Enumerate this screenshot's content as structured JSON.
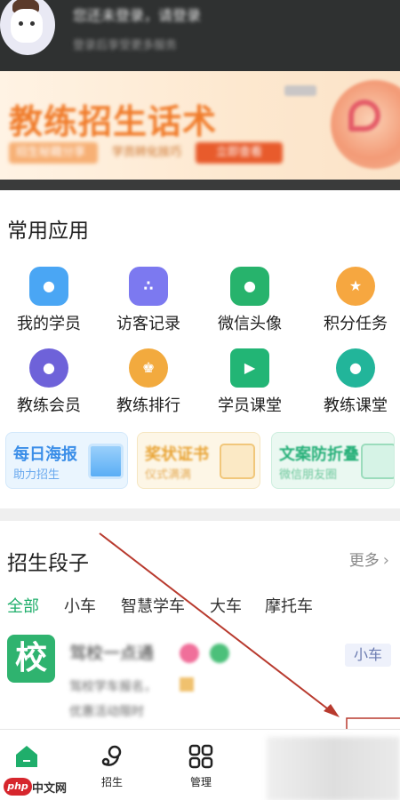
{
  "header": {
    "line1": "您还未登录，请登录",
    "line2": "登录后享受更多服务"
  },
  "banner": {
    "title": "教练招生话术",
    "chip1": "招生秘籍分享",
    "chip2": "学员转化技巧",
    "chip3": "立即查看"
  },
  "apps": {
    "title": "常用应用",
    "items": [
      {
        "label": "我的学员",
        "icon": "student-icon",
        "color": "#4aa6f4"
      },
      {
        "label": "访客记录",
        "icon": "footprint-icon",
        "color": "#7c79f0"
      },
      {
        "label": "微信头像",
        "icon": "profile-card-icon",
        "color": "#27b36c"
      },
      {
        "label": "积分任务",
        "icon": "star-icon",
        "color": "#f6a740"
      },
      {
        "label": "教练会员",
        "icon": "coach-member-icon",
        "color": "#6e62d9"
      },
      {
        "label": "教练排行",
        "icon": "trophy-icon",
        "color": "#f2aa3e"
      },
      {
        "label": "学员课堂",
        "icon": "video-play-icon",
        "color": "#22b575"
      },
      {
        "label": "教练课堂",
        "icon": "teacher-icon",
        "color": "#22b59a"
      }
    ],
    "promos": [
      {
        "title": "每日海报",
        "sub": "助力招生"
      },
      {
        "title": "奖状证书",
        "sub": "仪式满满"
      },
      {
        "title": "文案防折叠",
        "sub": "微信朋友圈"
      }
    ]
  },
  "recruit": {
    "title": "招生段子",
    "more": "更多",
    "tabs": [
      "全部",
      "小车",
      "智慧学车",
      "大车",
      "摩托车"
    ],
    "post": {
      "logo": "校",
      "name": "驾校一点通",
      "line1": "驾校学车报名，",
      "line2": "优惠活动限时",
      "tag": "小车"
    }
  },
  "bottom_nav": {
    "home": "首页",
    "recruit": "招生",
    "manage": "管理"
  },
  "watermark": {
    "brand": "php",
    "site": "中文网"
  },
  "colors": {
    "accent_green": "#1fae6b",
    "header_bg": "#2f3131",
    "arrow_red": "#c0392b"
  }
}
